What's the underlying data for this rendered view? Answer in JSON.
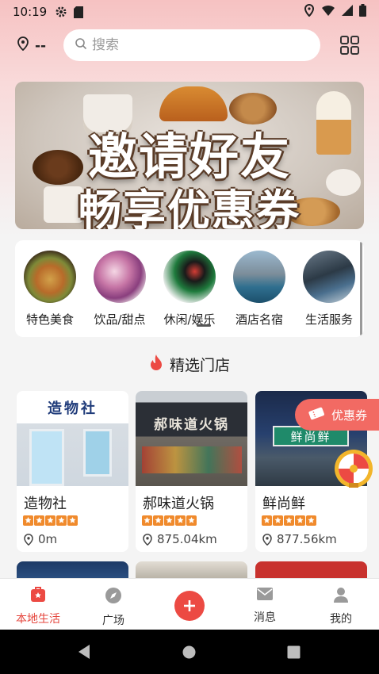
{
  "status_bar": {
    "time": "10:19"
  },
  "header": {
    "location": "--",
    "search_placeholder": "搜索"
  },
  "banner": {
    "line1": "邀请好友",
    "line2": "畅享优惠券"
  },
  "categories": [
    {
      "label": "特色美食"
    },
    {
      "label": "饮品/甜点"
    },
    {
      "label": "休闲/娱乐"
    },
    {
      "label": "酒店名宿"
    },
    {
      "label": "生活服务"
    }
  ],
  "section": {
    "title": "精选门店"
  },
  "stores": [
    {
      "name": "造物社",
      "sign": "造物社",
      "rating": 5,
      "distance": "0m"
    },
    {
      "name": "郝味道火锅",
      "sign": "郝味道火锅",
      "rating": 5,
      "distance": "875.04km"
    },
    {
      "name": "鲜尚鲜",
      "sign": "鲜尚鲜",
      "rating": 5,
      "distance": "877.56km"
    }
  ],
  "coupon": {
    "label": "优惠券"
  },
  "nav": [
    {
      "label": "本地生活",
      "active": true
    },
    {
      "label": "广场",
      "active": false
    },
    {
      "label": "消息",
      "active": false
    },
    {
      "label": "我的",
      "active": false
    }
  ],
  "colors": {
    "accent": "#ec4a43",
    "star": "#f08a2c"
  }
}
